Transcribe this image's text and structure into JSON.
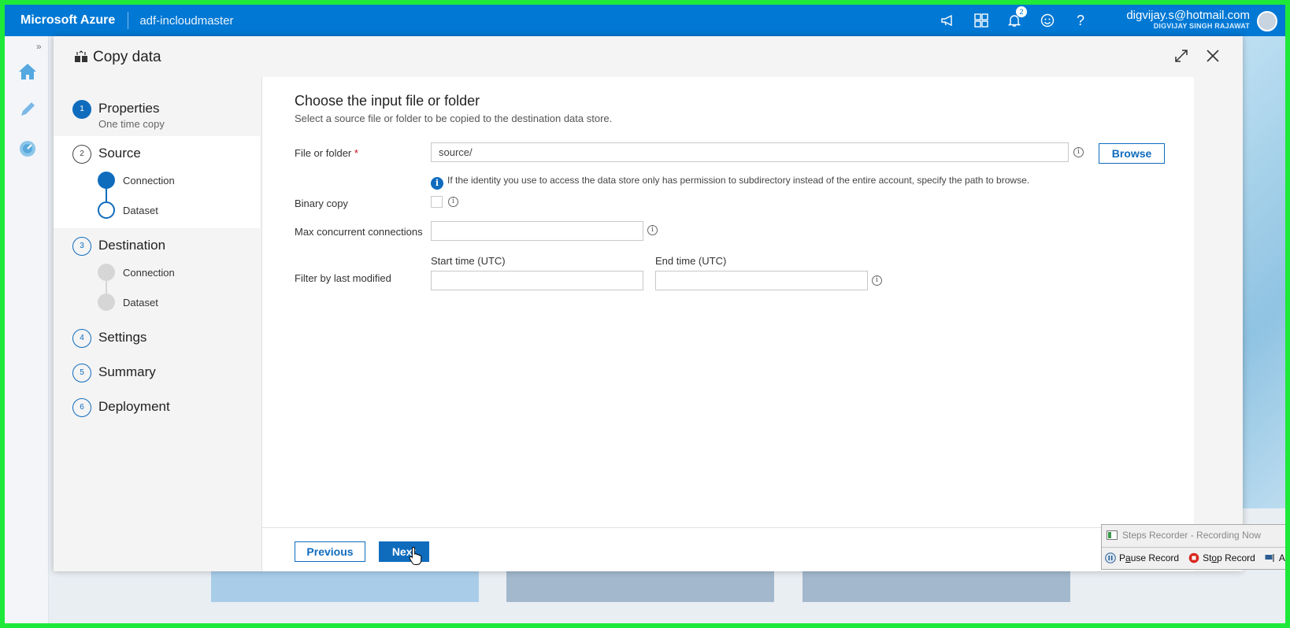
{
  "topbar": {
    "brand": "Microsoft Azure",
    "factory_name": "adf-incloudmaster",
    "notification_count": "2",
    "user_email": "digvijay.s@hotmail.com",
    "user_name": "DIGVIJAY SINGH RAJAWAT",
    "icons": [
      "megaphone-icon",
      "portal-icon",
      "bell-icon",
      "smiley-icon",
      "help-icon"
    ]
  },
  "dialog": {
    "title": "Copy data"
  },
  "steps": [
    {
      "number": "1",
      "title": "Properties",
      "subtitle": "One time copy"
    },
    {
      "number": "2",
      "title": "Source",
      "subs": [
        "Connection",
        "Dataset"
      ]
    },
    {
      "number": "3",
      "title": "Destination",
      "subs": [
        "Connection",
        "Dataset"
      ]
    },
    {
      "number": "4",
      "title": "Settings"
    },
    {
      "number": "5",
      "title": "Summary"
    },
    {
      "number": "6",
      "title": "Deployment"
    }
  ],
  "panel": {
    "title": "Choose the input file or folder",
    "description": "Select a source file or folder to be copied to the destination data store.",
    "file_label": "File or folder",
    "required_mark": "*",
    "file_value": "source/",
    "browse_label": "Browse",
    "hint": "If the identity you use to access the data store only has permission to subdirectory instead of the entire account, specify the path to browse.",
    "binary_label": "Binary copy",
    "max_conn_label": "Max concurrent connections",
    "max_conn_value": "",
    "filter_label": "Filter by last modified",
    "start_label": "Start time (UTC)",
    "end_label": "End time (UTC)",
    "start_value": "",
    "end_value": "",
    "previous_label": "Previous",
    "next_label": "Next"
  },
  "recorder": {
    "title": "Steps Recorder - Recording Now",
    "pause_label_pre": "P",
    "pause_label_ul": "a",
    "pause_label_post": "use Record",
    "stop_label_pre": "St",
    "stop_label_ul": "o",
    "stop_label_post": "p Record",
    "extra_label": "A"
  },
  "colors": {
    "azure_blue": "#0078d4",
    "accent": "#0f6cbd",
    "frame_green": "#1ee83a"
  }
}
